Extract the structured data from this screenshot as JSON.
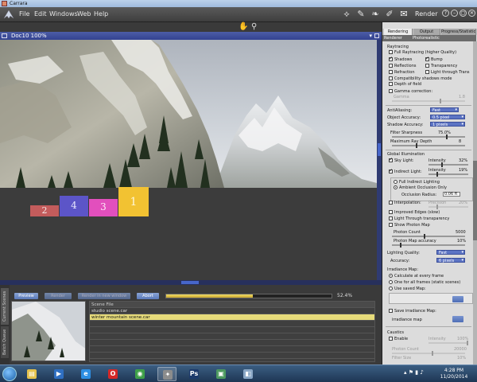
{
  "window": {
    "title": "Carrara"
  },
  "menu": [
    "File",
    "Edit",
    "Windows",
    "Web",
    "Help"
  ],
  "room": {
    "label": "Render"
  },
  "mode_icons": [
    "assemble-icon",
    "model-icon",
    "storyboard-icon",
    "texture-icon",
    "render-icon"
  ],
  "window_controls": [
    "?",
    "–",
    "▢",
    "✕"
  ],
  "toolbar2": {
    "icons": [
      "hand-icon",
      "zoom-icon"
    ]
  },
  "document": {
    "title": "Doc10 100%"
  },
  "scene": {
    "podium": [
      {
        "label": "2",
        "color": "#c35c5c"
      },
      {
        "label": "4",
        "color": "#5c55c8"
      },
      {
        "label": "3",
        "color": "#e24fbd"
      },
      {
        "label": "1",
        "color": "#f2c232"
      }
    ]
  },
  "queue": {
    "tabs": [
      "Current Scenes",
      "Batch Queue"
    ],
    "buttons": [
      "Preview",
      "Render",
      "Render in new window",
      "Abort"
    ],
    "progress": {
      "value": 0.524,
      "label": "52.4%"
    },
    "list_header": "Scene File",
    "files": [
      "studio scene.car",
      "winter mountain scene.car"
    ],
    "selected_index": 1
  },
  "panel": {
    "tabs": [
      "Rendering",
      "Output",
      "Progress/Statistic"
    ],
    "subheader": {
      "left": "Renderer",
      "right": "Photorealistic"
    },
    "raytracing": {
      "title": "Raytracing",
      "full": "Full Raytracing (higher Quality)",
      "shadows": "Shadows",
      "bump": "Bump",
      "reflections": "Reflections",
      "transparency": "Transparency",
      "refraction": "Refraction",
      "light_through": "Light through Trans",
      "compat": "Compatibility shadows mode",
      "dof": "Depth of field",
      "gamma": "Gamma correction:",
      "gamma_lbl": "Gamma",
      "gamma_val": "1.8"
    },
    "antialias": {
      "label": "AntiAliasing:",
      "value": "Fast"
    },
    "object_accuracy": {
      "label": "Object Accuracy:",
      "value": "0.5 pixel"
    },
    "shadow_accuracy": {
      "label": "Shadow Accuracy:",
      "value": "1 pixels"
    },
    "filter": {
      "label": "Filter Sharpness",
      "value": "75.0%"
    },
    "raydepth": {
      "label": "Maximum Ray Depth",
      "value": "8"
    },
    "gi": {
      "title": "Global Illumination",
      "sky": "Sky Light:",
      "sky_int_lbl": "Intensity",
      "sky_int": "32%",
      "indirect": "Indirect Light:",
      "ind_int_lbl": "Intensity",
      "ind_int": "19%",
      "full_indirect": "Full Indirect Lighting",
      "ambient_occ": "Ambient Occlusion Only",
      "occ_radius_lbl": "Occlusion Radius:",
      "occ_radius": "0.06 ft",
      "interp": "Interpolation:",
      "precision_lbl": "Precision",
      "precision": "20%",
      "improved_edges": "Improved Edges (slow)",
      "light_through": "Light Through transparency",
      "photon_map": "Show Photon Map",
      "photon_count_lbl": "Photon Count",
      "photon_count": "5000",
      "photon_acc_lbl": "Photon Map accuracy",
      "photon_acc": "10%",
      "lighting_quality_lbl": "Lighting Quality:",
      "lighting_quality": "Fast",
      "accuracy_lbl": "Accuracy:",
      "accuracy": "6 pixels"
    },
    "irradiance": {
      "title": "Irradiance Map:",
      "opt1": "Calculate at every frame",
      "opt2": "One for all frames (static scenes)",
      "opt3": "Use saved Map:",
      "save": "Save irradiance Map:",
      "field": "irradiance map"
    },
    "caustics": {
      "title": "Caustics",
      "enable": "Enable",
      "int_lbl": "Intensity",
      "int": "100%",
      "photon_lbl": "Photon Count",
      "photon": "20000",
      "filter_lbl": "Filter Size",
      "filter": "10%"
    }
  },
  "taskbar": {
    "apps": [
      {
        "name": "explorer-icon",
        "glyph": "▤",
        "color": "#e5c24d"
      },
      {
        "name": "media-player-icon",
        "glyph": "▶",
        "color": "#2f6fc2"
      },
      {
        "name": "ie-icon",
        "glyph": "e",
        "color": "#2d8fe3"
      },
      {
        "name": "opera-icon",
        "glyph": "O",
        "color": "#d62828"
      },
      {
        "name": "chrome-icon",
        "glyph": "◉",
        "color": "#3fa049"
      },
      {
        "name": "carrara-icon",
        "glyph": "✦",
        "color": "#8c8c8c"
      },
      {
        "name": "photoshop-icon",
        "glyph": "Ps",
        "color": "#1d3a6b"
      },
      {
        "name": "monitor-icon",
        "glyph": "▣",
        "color": "#4d9960"
      },
      {
        "name": "remote-icon",
        "glyph": "◧",
        "color": "#8aa7c6"
      }
    ],
    "active_index": 5,
    "time": "4:28 PM",
    "date": "11/20/2014"
  }
}
